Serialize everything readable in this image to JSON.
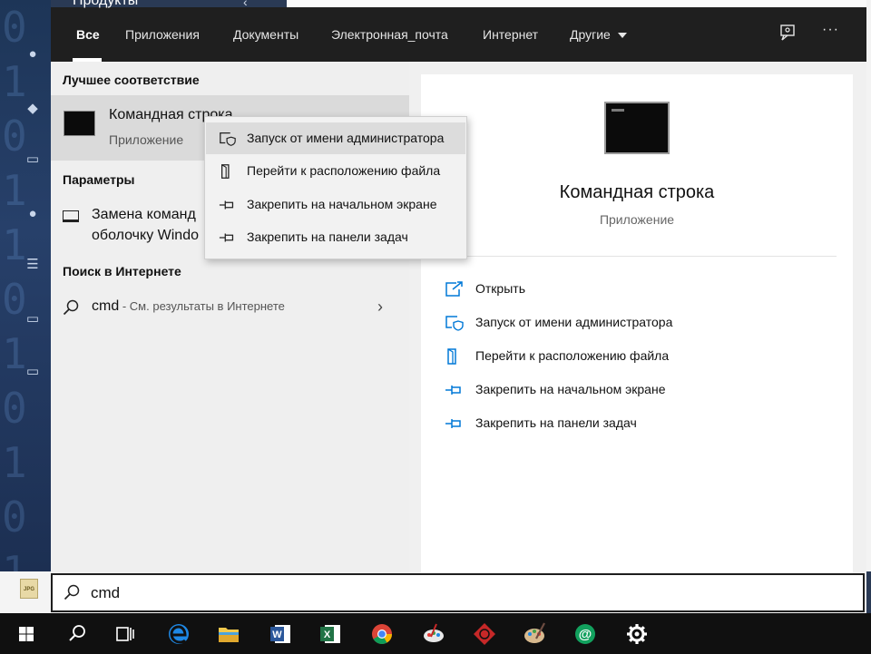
{
  "background": {
    "window_title": "Продукты",
    "binary_text": "0\n1\n0\n1\n1\n0\n1\n0\n1\n0\n1"
  },
  "tabs": [
    {
      "label": "Все",
      "active": true
    },
    {
      "label": "Приложения"
    },
    {
      "label": "Документы"
    },
    {
      "label": "Электронная_почта"
    },
    {
      "label": "Интернет"
    },
    {
      "label": "Другие"
    }
  ],
  "top_icons": {
    "feedback": "feedback-icon",
    "more": "···"
  },
  "best_match": {
    "heading": "Лучшее соответствие",
    "title": "Командная строка",
    "subtitle": "Приложение"
  },
  "settings": {
    "heading": "Параметры",
    "line1": "Замена команд",
    "line2": "оболочку Windo"
  },
  "web": {
    "heading": "Поиск в Интернете",
    "query": "cmd",
    "suffix": " - См. результаты в Интернете"
  },
  "context_menu": [
    {
      "label": "Запуск от имени администратора",
      "icon": "shield-icon"
    },
    {
      "label": "Перейти к расположению файла",
      "icon": "file-location-icon"
    },
    {
      "label": "Закрепить на начальном экране",
      "icon": "pin-icon"
    },
    {
      "label": "Закрепить на панели задач",
      "icon": "pin-icon"
    }
  ],
  "details": {
    "title": "Командная строка",
    "subtitle": "Приложение",
    "actions": [
      {
        "label": "Открыть",
        "icon": "open-icon"
      },
      {
        "label": "Запуск от имени администратора",
        "icon": "shield-icon"
      },
      {
        "label": "Перейти к расположению файла",
        "icon": "file-location-icon"
      },
      {
        "label": "Закрепить на начальном экране",
        "icon": "pin-icon"
      },
      {
        "label": "Закрепить на панели задач",
        "icon": "pin-icon"
      }
    ]
  },
  "search": {
    "value": "cmd"
  },
  "taskbar": [
    "windows-start-icon",
    "search-icon",
    "task-view-icon",
    "edge-icon",
    "file-explorer-icon",
    "word-icon",
    "excel-icon",
    "chrome-icon",
    "paint-icon",
    "game-icon",
    "palette-icon",
    "mail-icon",
    "settings-gear-icon"
  ],
  "colors": {
    "accent": "#0078d7",
    "topbar": "#1f1f1f",
    "taskbar": "#101010"
  }
}
